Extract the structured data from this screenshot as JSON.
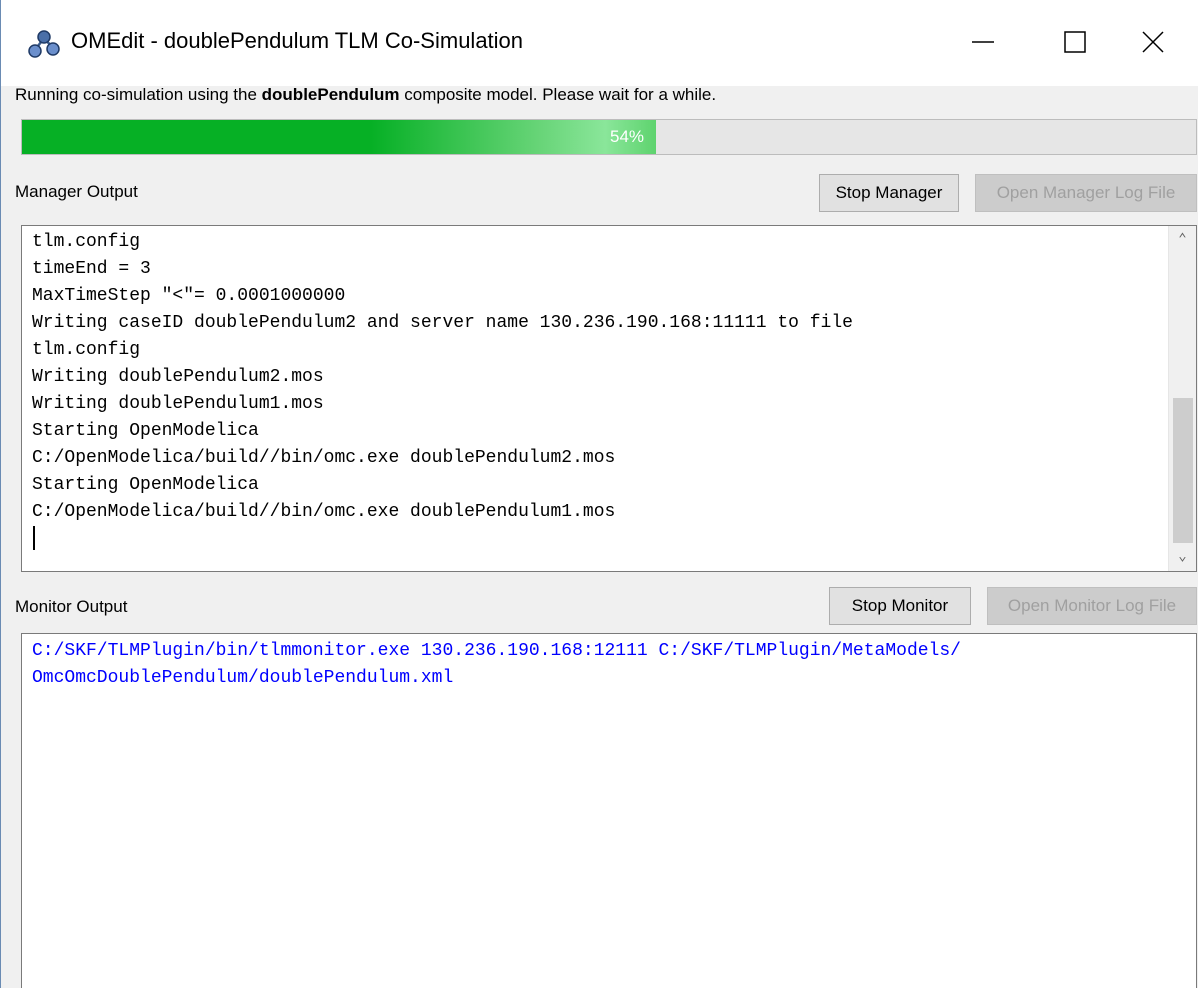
{
  "window": {
    "title": "OMEdit - doublePendulum TLM Co-Simulation"
  },
  "status": {
    "prefix": "Running co-simulation using the ",
    "model": "doublePendulum",
    "suffix": " composite model. Please wait for a while."
  },
  "progress": {
    "percent": 54,
    "label": "54%",
    "color": "#06b025"
  },
  "manager": {
    "label": "Manager Output",
    "stop_button": "Stop Manager",
    "log_button": "Open Manager Log File",
    "lines": [
      "tlm.config",
      "timeEnd = 3",
      "MaxTimeStep \"<\"= 0.0001000000",
      "Writing caseID doublePendulum2 and server name 130.236.190.168:11111 to file",
      "tlm.config",
      "Writing doublePendulum2.mos",
      "Writing doublePendulum1.mos",
      "Starting OpenModelica",
      "C:/OpenModelica/build//bin/omc.exe doublePendulum2.mos",
      "Starting OpenModelica",
      "C:/OpenModelica/build//bin/omc.exe doublePendulum1.mos"
    ]
  },
  "monitor": {
    "label": "Monitor Output",
    "stop_button": "Stop Monitor",
    "log_button": "Open Monitor Log File",
    "text_color": "#0000ff",
    "lines": [
      "C:/SKF/TLMPlugin/bin/tlmmonitor.exe 130.236.190.168:12111 C:/SKF/TLMPlugin/MetaModels/",
      "OmcOmcDoublePendulum/doublePendulum.xml"
    ]
  }
}
